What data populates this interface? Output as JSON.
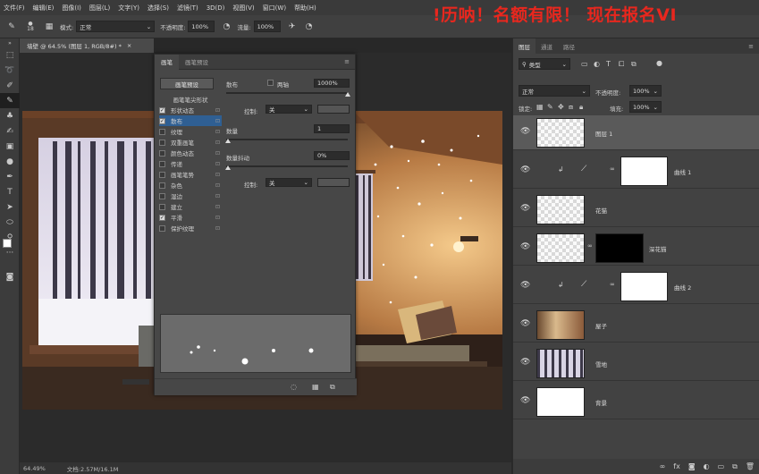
{
  "menu": [
    "文件(F)",
    "编辑(E)",
    "图像(I)",
    "图层(L)",
    "文字(Y)",
    "选择(S)",
    "滤镜(T)",
    "3D(D)",
    "视图(V)",
    "窗口(W)",
    "帮助(H)"
  ],
  "banner": "!历呐！名额有限！  现在报名VI",
  "options": {
    "brush_size": "18",
    "mode_label": "模式:",
    "mode_value": "正常",
    "opacity_label": "不透明度:",
    "opacity_value": "100%",
    "flow_label": "流量:",
    "flow_value": "100%"
  },
  "document": {
    "tab_title": "墙壁 @ 64.5% (图层 1, RGB/8#) *",
    "zoom": "64.49%",
    "doc_size": "文档:2.57M/16.1M"
  },
  "brush_panel": {
    "tabs": [
      "画笔",
      "画笔预设"
    ],
    "preset_button": "画笔预设",
    "section_header": "画笔笔尖形状",
    "items": [
      {
        "label": "形状动态",
        "checked": true
      },
      {
        "label": "散布",
        "checked": true,
        "selected": true
      },
      {
        "label": "纹理",
        "checked": false
      },
      {
        "label": "双重画笔",
        "checked": false
      },
      {
        "label": "颜色动态",
        "checked": false
      },
      {
        "label": "传递",
        "checked": false
      },
      {
        "label": "画笔笔势",
        "checked": false
      },
      {
        "label": "杂色",
        "checked": false
      },
      {
        "label": "湿边",
        "checked": false
      },
      {
        "label": "建立",
        "checked": false
      },
      {
        "label": "平滑",
        "checked": true
      },
      {
        "label": "保护纹理",
        "checked": false
      }
    ],
    "scatter_label": "散布",
    "both_axes_label": "两轴",
    "scatter_value": "1000%",
    "control_label": "控制:",
    "control_value": "关",
    "count_label": "数量",
    "count_value": "1",
    "count_jitter_label": "数量抖动",
    "count_jitter_value": "0%",
    "control2_label": "控制:",
    "control2_value": "关"
  },
  "layers_panel": {
    "tabs": [
      "图层",
      "通道",
      "路径"
    ],
    "kind_label": "类型",
    "blend_mode": "正常",
    "opacity_label": "不透明度:",
    "opacity_value": "100%",
    "lock_label": "锁定:",
    "fill_label": "填充:",
    "fill_value": "100%",
    "layers": [
      {
        "name": "图层 1",
        "type": "empty",
        "selected": true
      },
      {
        "name": "曲线 1",
        "type": "adjustment"
      },
      {
        "name": "花猫",
        "type": "pixel"
      },
      {
        "name": "深花猫",
        "type": "masked"
      },
      {
        "name": "曲线 2",
        "type": "adjustment"
      },
      {
        "name": "屋子",
        "type": "photo"
      },
      {
        "name": "雪地",
        "type": "snow"
      },
      {
        "name": "背景",
        "type": "white"
      }
    ]
  },
  "colors": {
    "banner_red": "#e8271e",
    "selected_item_blue": "#2f5f93"
  }
}
